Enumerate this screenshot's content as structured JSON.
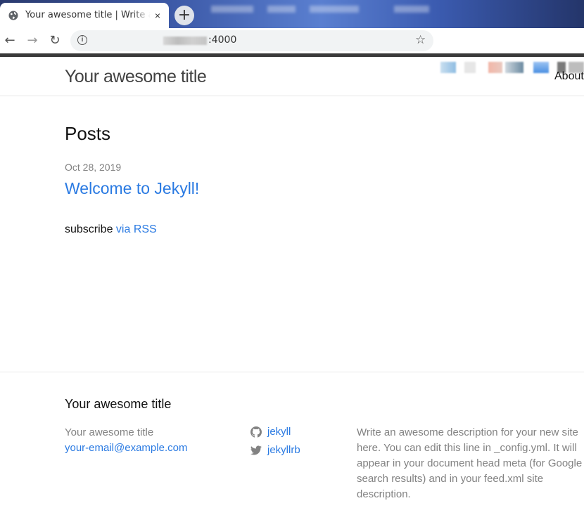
{
  "browser": {
    "tab_title": "Your awesome title | Write an awesome description",
    "new_tab_label": "+",
    "close_label": "×",
    "url_suffix": ":4000",
    "back": "←",
    "forward": "→",
    "reload": "↻",
    "star": "☆"
  },
  "header": {
    "site_title": "Your awesome title",
    "nav": [
      {
        "label": "About"
      }
    ]
  },
  "main": {
    "heading": "Posts",
    "posts": [
      {
        "date": "Oct 28, 2019",
        "title": "Welcome to Jekyll!"
      }
    ],
    "subscribe_prefix": "subscribe ",
    "subscribe_link": "via RSS"
  },
  "footer": {
    "heading": "Your awesome title",
    "name": "Your awesome title",
    "email": "your-email@example.com",
    "social": [
      {
        "icon": "github-icon",
        "label": "jekyll"
      },
      {
        "icon": "twitter-icon",
        "label": "jekyllrb"
      }
    ],
    "description": "Write an awesome description for your new site here. You can edit this line in _config.yml. It will appear in your document head meta (for Google search results) and in your feed.xml site description."
  },
  "colors": {
    "link": "#2a7ae2",
    "text": "#111111",
    "muted": "#828282",
    "border": "#e8e8e8"
  }
}
